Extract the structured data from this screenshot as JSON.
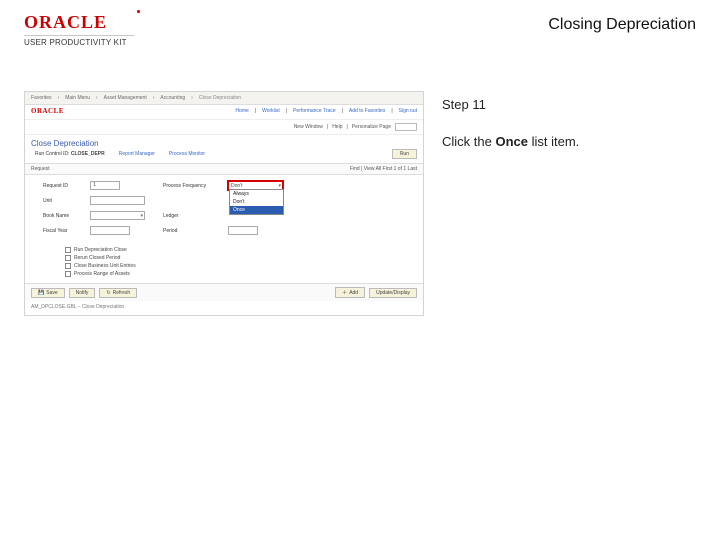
{
  "brand": {
    "logo": "ORACLE",
    "subline": "USER PRODUCTIVITY KIT"
  },
  "page_title": "Closing Depreciation",
  "step": {
    "label": "Step 11",
    "instruction_prefix": "Click the ",
    "instruction_bold": "Once",
    "instruction_suffix": " list item."
  },
  "shot": {
    "breadcrumb": [
      "Favorites",
      "Main Menu",
      "Asset Management",
      "Accounting",
      "Close Depreciation"
    ],
    "toplinks": [
      "Home",
      "Worklist",
      "Performance Trace",
      "Add to Favorites",
      "Sign out"
    ],
    "new_window": "New Window",
    "help": "Help",
    "personalize": "Personalize Page",
    "panel_title": "Close Depreciation",
    "run_ctrl_lbl": "Run Control ID:",
    "run_ctrl_val": "CLOSE_DEPR",
    "report_mgr": "Report Manager",
    "proc_mon": "Process Monitor",
    "run_btn": "Run",
    "tab_label": "Request",
    "pager": "Find | View All   First  1 of 1  Last",
    "fields": {
      "request_id_lbl": "Request ID",
      "request_id_val": "1",
      "proc_freq_lbl": "Process Frequency",
      "proc_freq_val": "Don't",
      "unit_lbl": "Unit",
      "book_lbl": "Book Name",
      "ledger_lbl": "Ledger",
      "period_lbl": "Period",
      "fy_lbl": "Fiscal Year"
    },
    "dropdown": {
      "options": [
        "Always",
        "Don't",
        "Once"
      ],
      "highlight_index": 2
    },
    "checkboxes": [
      "Run Depreciation Close",
      "Rerun Closed Period",
      "Close Business Unit Entries",
      "Process Range of Assets"
    ],
    "footer": {
      "save": "Save",
      "notify": "Notify",
      "refresh": "Refresh",
      "add": "Add",
      "update": "Update/Display"
    },
    "audit": "AM_DPCLOSE.GBL – Close Depreciation"
  }
}
